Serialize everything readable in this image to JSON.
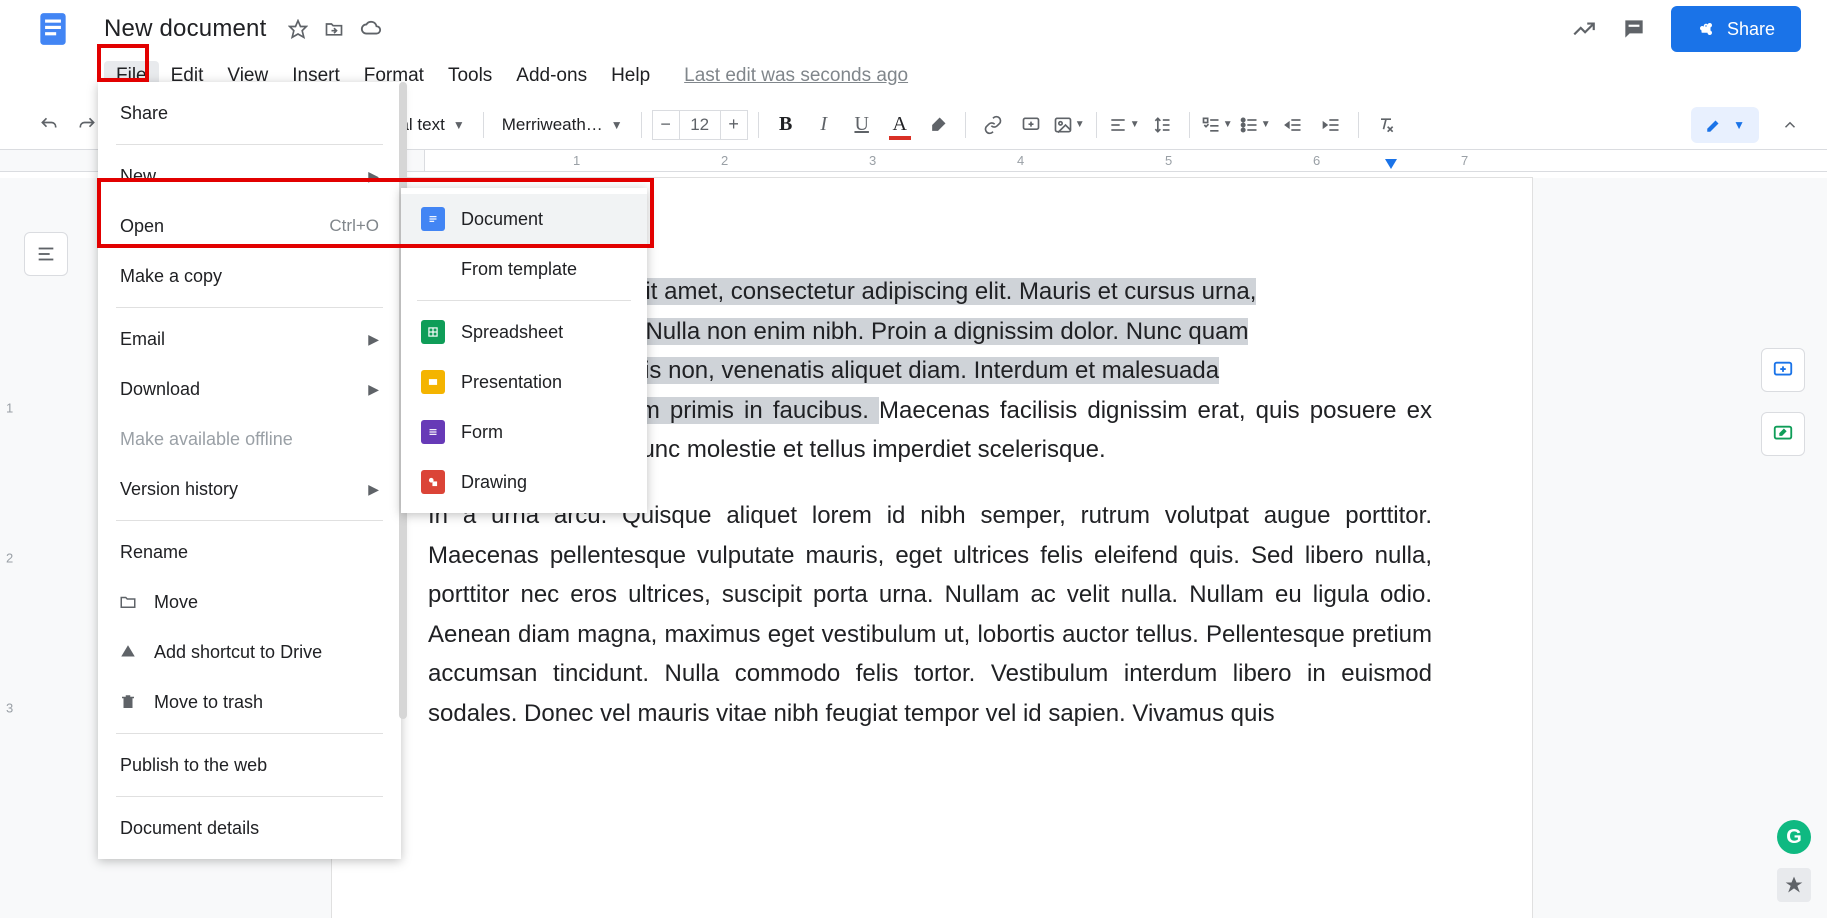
{
  "header": {
    "doc_title": "New document",
    "share_label": "Share",
    "last_edit": "Last edit was seconds ago"
  },
  "menubar": {
    "items": [
      "File",
      "Edit",
      "View",
      "Insert",
      "Format",
      "Tools",
      "Add-ons",
      "Help"
    ]
  },
  "toolbar": {
    "style_combo": "Normal text",
    "style_combo_truncated": "nal text",
    "font_combo": "Merriweath…",
    "font_size": "12"
  },
  "file_menu": {
    "share": "Share",
    "new": "New",
    "open": {
      "label": "Open",
      "shortcut": "Ctrl+O"
    },
    "make_copy": "Make a copy",
    "email": "Email",
    "download": "Download",
    "offline": "Make available offline",
    "version_history": "Version history",
    "rename": "Rename",
    "move": "Move",
    "add_shortcut": "Add shortcut to Drive",
    "trash": "Move to trash",
    "publish": "Publish to the web",
    "details": "Document details"
  },
  "new_submenu": {
    "document": "Document",
    "from_template": "From template",
    "spreadsheet": "Spreadsheet",
    "presentation": "Presentation",
    "form": "Form",
    "drawing": "Drawing"
  },
  "document_body": {
    "p1_sel": "or sit amet, consectetur adipiscing elit. Mauris et cursus urna, ",
    "p1_line2_sel_prefix": "en. Nulla non enim nibh. Proin a dignissim dolor. Nunc quam ",
    "p1_line3_sel": "d felis non, venenatis aliquet diam. Interdum et malesuada ",
    "p1_line4_sel": "um primis in faucibus. ",
    "p1_rest": "Maecenas facilisis dignissim erat, quis posuere ex posuere pharetra. Nunc molestie et tellus imperdiet scelerisque.",
    "p2": "In a urna arcu. Quisque aliquet lorem id nibh semper, rutrum volutpat augue porttitor. Maecenas pellentesque vulputate mauris, eget ultrices felis eleifend quis. Sed libero nulla, porttitor nec eros ultrices, suscipit porta urna. Nullam ac velit nulla. Nullam eu ligula odio. Aenean diam magna, maximus eget vestibulum ut, lobortis auctor tellus. Pellentesque pretium accumsan tincidunt. Nulla commodo felis tortor. Vestibulum interdum libero in euismod sodales. Donec vel mauris vitae nibh feugiat tempor vel id sapien. Vivamus quis"
  },
  "ruler": {
    "numbers": [
      "1",
      "2",
      "3",
      "4",
      "5",
      "6",
      "7"
    ]
  },
  "vruler": {
    "numbers": [
      "1",
      "2",
      "3"
    ]
  }
}
